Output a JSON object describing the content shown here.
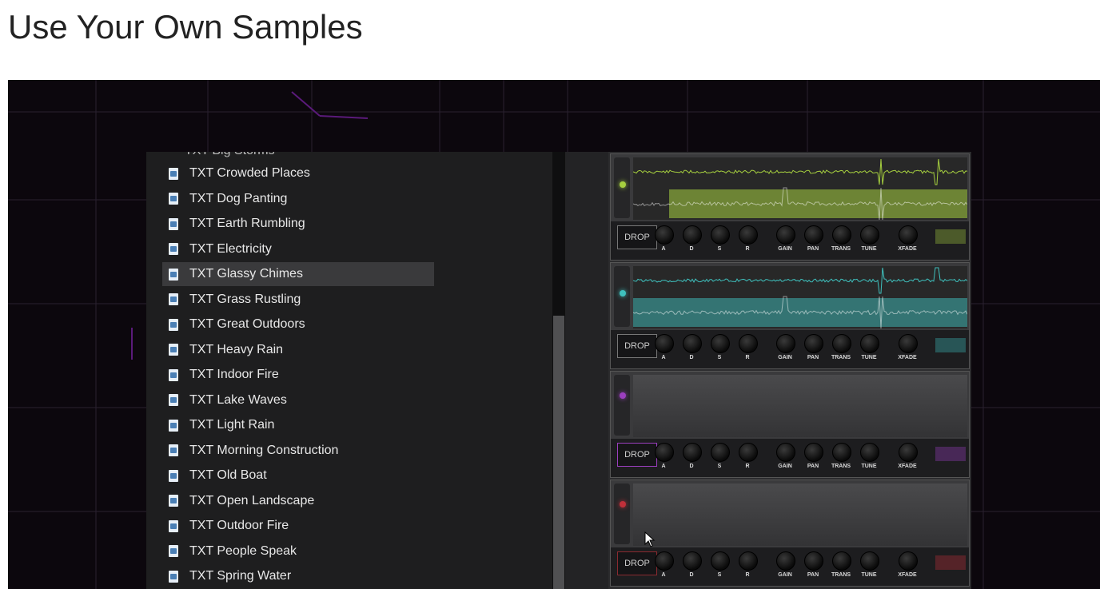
{
  "page": {
    "title": "Use Your Own Samples"
  },
  "browser": {
    "partial_item": "TXT Big Storms",
    "items": [
      {
        "label": "TXT Crowded Places"
      },
      {
        "label": "TXT Dog Panting"
      },
      {
        "label": "TXT Earth Rumbling"
      },
      {
        "label": "TXT Electricity"
      },
      {
        "label": "TXT Glassy Chimes",
        "selected": true
      },
      {
        "label": "TXT Grass Rustling"
      },
      {
        "label": "TXT Great Outdoors"
      },
      {
        "label": "TXT Heavy Rain"
      },
      {
        "label": "TXT Indoor Fire"
      },
      {
        "label": "TXT Lake Waves"
      },
      {
        "label": "TXT Light Rain"
      },
      {
        "label": "TXT Morning Construction"
      },
      {
        "label": "TXT Old Boat"
      },
      {
        "label": "TXT Open Landscape"
      },
      {
        "label": "TXT Outdoor Fire"
      },
      {
        "label": "TXT People Speak"
      },
      {
        "label": "TXT Spring Water"
      }
    ]
  },
  "sampler": {
    "knob_labels": [
      "A",
      "D",
      "S",
      "R",
      "GAIN",
      "PAN",
      "TRANS",
      "TUNE",
      "XFADE"
    ],
    "slots": [
      {
        "drop_label": "DROP",
        "color": "#a6cf3f",
        "loaded": true
      },
      {
        "drop_label": "DROP",
        "color": "#3fc0bd",
        "loaded": true
      },
      {
        "drop_label": "DROP",
        "color": "#9b3fbf",
        "loaded": false
      },
      {
        "drop_label": "DROP",
        "color": "#c0303a",
        "loaded": false
      }
    ]
  },
  "icons": {
    "file": "text-file-icon",
    "cursor": "mouse-pointer-icon"
  }
}
